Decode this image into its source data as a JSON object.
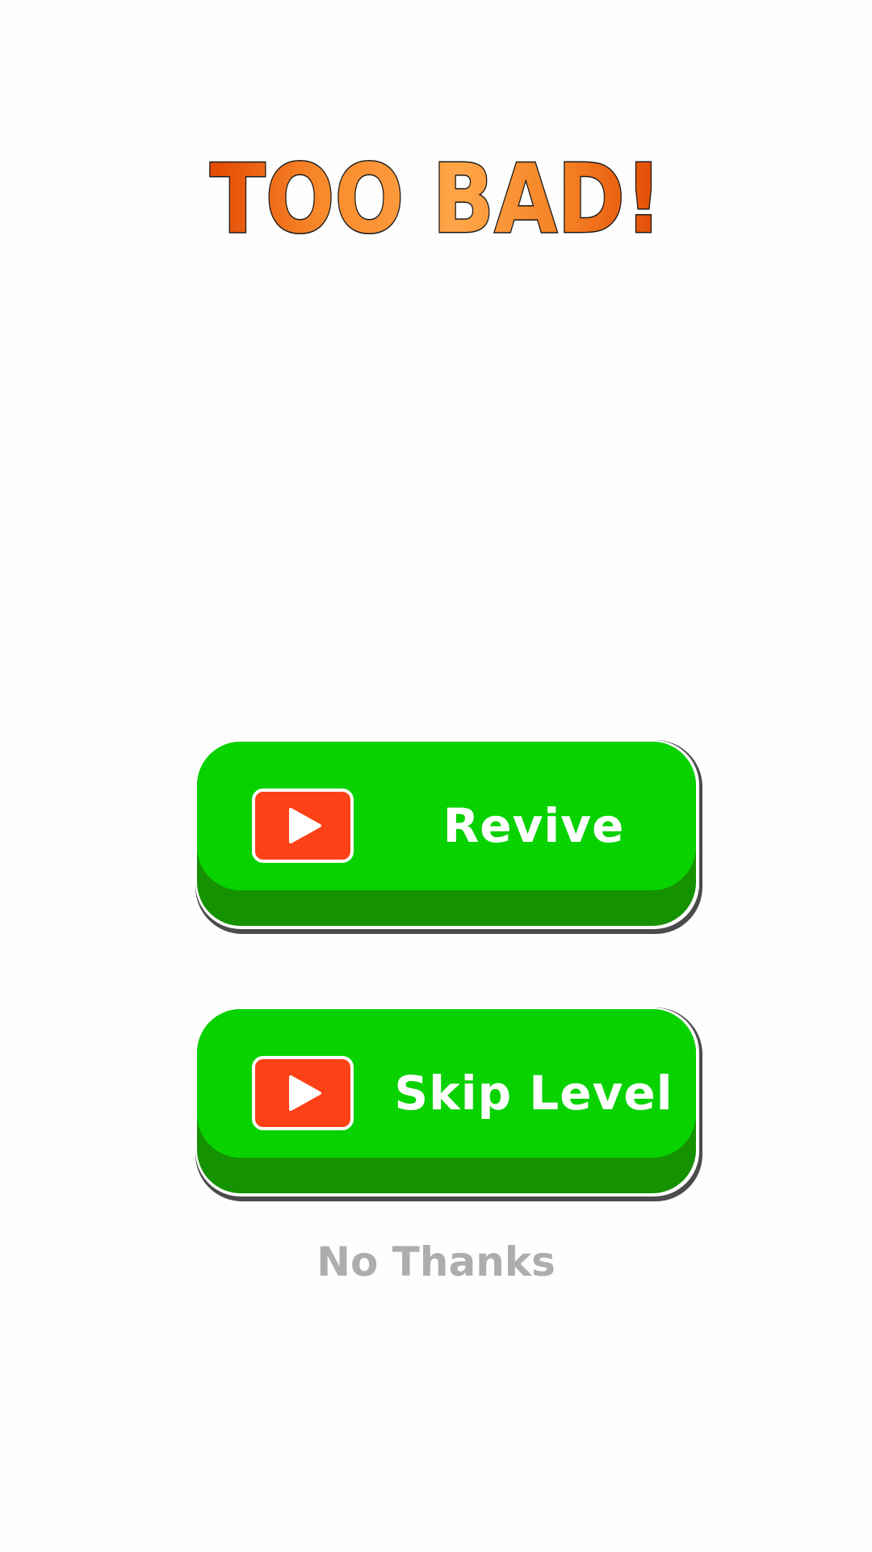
{
  "screen": {
    "title": "TOO BAD!",
    "buttons": {
      "revive": {
        "label": "Revive",
        "icon": "play-icon"
      },
      "skip_level": {
        "label": "Skip Level",
        "icon": "play-icon"
      }
    },
    "no_thanks_label": "No Thanks"
  },
  "colors": {
    "title_gradient": [
      "#e95207",
      "#ff9f40",
      "#e14d05"
    ],
    "button_face": "#08d200",
    "button_base": "#159200",
    "play_badge": "#fd4116",
    "no_thanks_text": "#adadad"
  }
}
